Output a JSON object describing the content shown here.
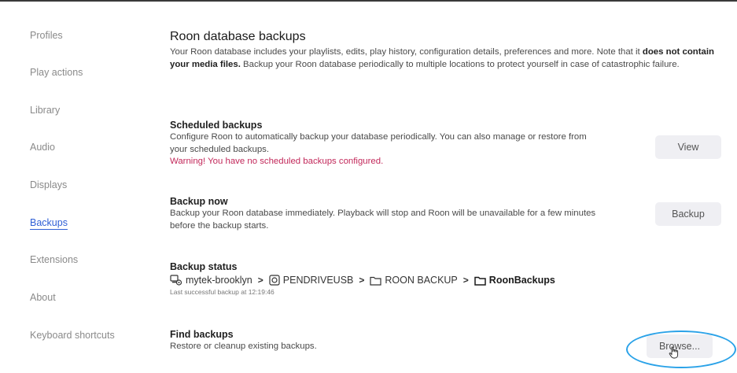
{
  "sidebar": {
    "items": [
      {
        "label": "Profiles",
        "active": false
      },
      {
        "label": "Play actions",
        "active": false
      },
      {
        "label": "Library",
        "active": false
      },
      {
        "label": "Audio",
        "active": false
      },
      {
        "label": "Displays",
        "active": false
      },
      {
        "label": "Backups",
        "active": true
      },
      {
        "label": "Extensions",
        "active": false
      },
      {
        "label": "About",
        "active": false
      },
      {
        "label": "Keyboard shortcuts",
        "active": false
      }
    ]
  },
  "main": {
    "title": "Roon database backups",
    "intro": {
      "part1": "Your Roon database includes your playlists, edits, play history, configuration details, preferences and more. Note that it ",
      "bold": "does not contain your media files.",
      "part2": " Backup your Roon database periodically to multiple locations to protect yourself in case of catastrophic failure."
    },
    "scheduled": {
      "title": "Scheduled backups",
      "description": "Configure Roon to automatically backup your database periodically. You can also manage or restore from your scheduled backups.",
      "warning": "Warning! You have no scheduled backups configured.",
      "button_label": "View"
    },
    "backup_now": {
      "title": "Backup now",
      "description": "Backup your Roon database immediately. Playback will stop and Roon will be unavailable for a few minutes before the backup starts.",
      "button_label": "Backup"
    },
    "status": {
      "title": "Backup status",
      "path": [
        {
          "label": "mytek-brooklyn",
          "icon": "network-drive-icon"
        },
        {
          "label": "PENDRIVEUSB",
          "icon": "usb-drive-icon"
        },
        {
          "label": "ROON BACKUP",
          "icon": "folder-icon"
        },
        {
          "label": "RoonBackups",
          "icon": "folder-icon"
        }
      ],
      "last_backup": "Last successful backup at 12:19:46"
    },
    "find": {
      "title": "Find backups",
      "description": "Restore or cleanup existing backups.",
      "button_label": "Browse..."
    }
  },
  "colors": {
    "accent": "#2f5fd6",
    "warning": "#c2285a",
    "highlight_ring": "#2aa2e8",
    "button_bg": "#efeff3"
  }
}
